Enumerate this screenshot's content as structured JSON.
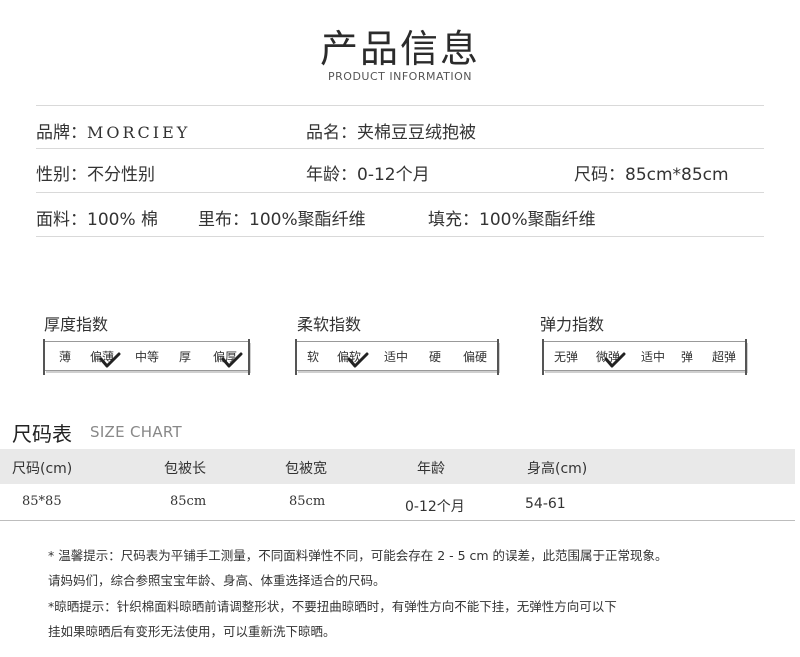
{
  "header": {
    "title": "产品信息",
    "subtitle": "PRODUCT INFORMATION"
  },
  "info": {
    "brand_label": "品牌：",
    "brand_value": "MORCIEY",
    "name_label": "品名：",
    "name_value": "夹棉豆豆绒抱被",
    "gender_label": "性别：",
    "gender_value": "不分性别",
    "age_label": "年龄：",
    "age_value": "0-12个月",
    "size_label": "尺码：",
    "size_value": "85cm*85cm",
    "fabric_label": "面料：",
    "fabric_value": "100% 棉",
    "lining_label": "里布：",
    "lining_value": "100%聚酯纤维",
    "filling_label": "填充：",
    "filling_value": "100%聚酯纤维"
  },
  "indices": [
    {
      "title": "厚度指数",
      "levels": [
        "薄",
        "偏薄",
        "中等",
        "厚",
        "偏厚"
      ],
      "checked_levels": [
        "偏薄",
        "偏厚"
      ]
    },
    {
      "title": "柔软指数",
      "levels": [
        "软",
        "偏软",
        "适中",
        "硬",
        "偏硬"
      ],
      "checked_levels": [
        "偏软"
      ]
    },
    {
      "title": "弹力指数",
      "levels": [
        "无弹",
        "微弹",
        "适中",
        "弹",
        "超弹"
      ],
      "checked_levels": [
        "微弹"
      ]
    }
  ],
  "size_chart": {
    "title": "尺码表",
    "subtitle": "SIZE CHART",
    "headers": [
      "尺码(cm)",
      "包被长",
      "包被宽",
      "年龄",
      "身高(cm)"
    ],
    "rows": [
      [
        "85*85",
        "85cm",
        "85cm",
        "0-12个月",
        "54-61"
      ]
    ]
  },
  "notes": [
    "* 温馨提示：尺码表为平铺手工测量，不同面料弹性不同，可能会存在  2 - 5 cm 的误差，此范围属于正常现象。",
    "请妈妈们，综合参照宝宝年龄、身高、体重选择适合的尺码。",
    "*晾晒提示：针织棉面料晾晒前请调整形状，不要扭曲晾晒时，有弹性方向不能下挂，无弹性方向可以下",
    "挂如果晾晒后有变形无法使用，可以重新洗下晾晒。"
  ],
  "colors": {
    "text": "#333333",
    "divider": "#d9d9d9",
    "header_band": "#e9e9e9"
  }
}
